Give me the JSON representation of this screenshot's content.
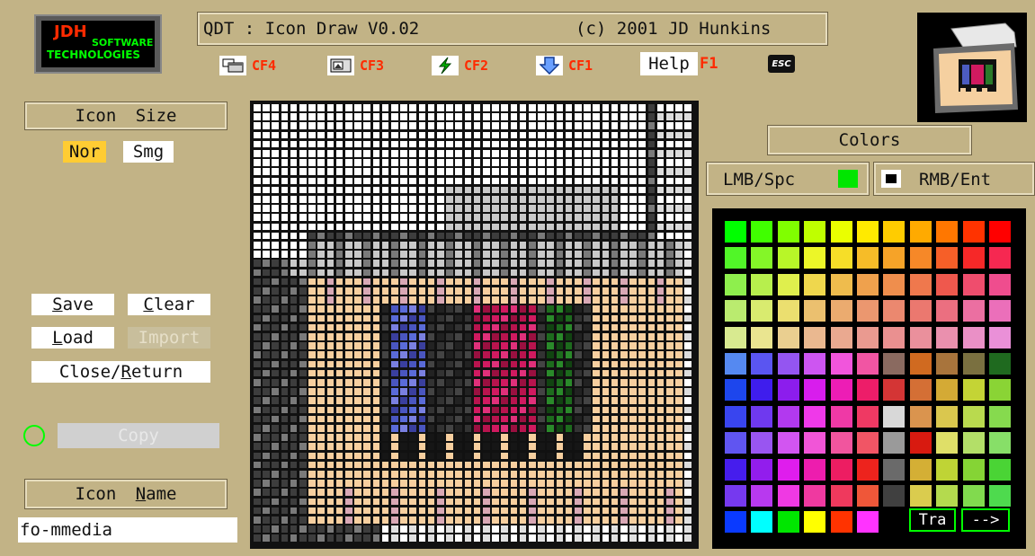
{
  "header": {
    "logo": {
      "line1": "JDH",
      "line2": "SOFTWARE",
      "line3": "TECHNOLOGIES"
    },
    "title_left": "QDT : Icon Draw V0.02",
    "title_right": "(c) 2001 JD Hunkins"
  },
  "toolbar": {
    "items": [
      {
        "icon": "window-restore-icon",
        "label": "CF4"
      },
      {
        "icon": "image-frame-icon",
        "label": "CF3"
      },
      {
        "icon": "green-bolt-icon",
        "label": "CF2"
      },
      {
        "icon": "down-arrow-icon",
        "label": "CF1"
      }
    ],
    "help_label": "Help",
    "help_key": "F1",
    "esc_label": "ESC"
  },
  "preview": {
    "icon": "multimedia-folder-icon"
  },
  "icon_size": {
    "title": "Icon Size",
    "options": [
      "Nor",
      "Smg"
    ],
    "selected": "Nor"
  },
  "file_buttons": {
    "save": "Save",
    "clear": "Clear",
    "load": "Load",
    "import": "Import",
    "close_return": "Close/Return"
  },
  "copy": {
    "label": "Copy",
    "enabled": false
  },
  "icon_name": {
    "title": "Icon Name",
    "value": "fo-mmedia"
  },
  "colors": {
    "title": "Colors",
    "lmb_label": "LMB/Spc",
    "lmb_color": "#00e600",
    "rmb_label": "RMB/Ent",
    "rmb_color": "#000000",
    "tra_label": "Tra",
    "next_label": "-->"
  },
  "accent_colors": {
    "panel": "#c2b386",
    "highlight": "#ffcc33",
    "error_red": "#ff2a00",
    "green": "#00ff00"
  }
}
